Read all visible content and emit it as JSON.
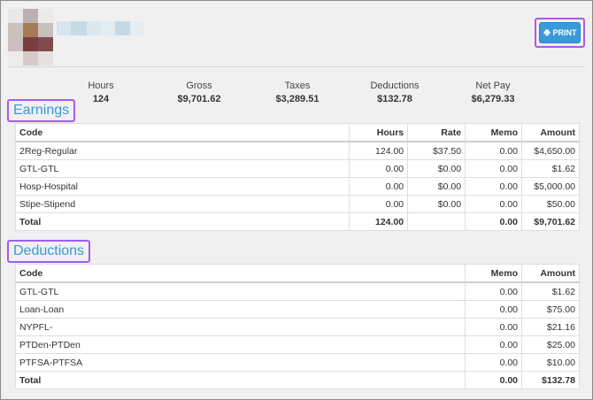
{
  "header": {
    "print_label": "PRINT"
  },
  "summary": {
    "items": [
      {
        "label": "Hours",
        "value": "124"
      },
      {
        "label": "Gross",
        "value": "$9,701.62"
      },
      {
        "label": "Taxes",
        "value": "$3,289.51"
      },
      {
        "label": "Deductions",
        "value": "$132.78"
      },
      {
        "label": "Net Pay",
        "value": "$6,279.33"
      }
    ]
  },
  "earnings": {
    "title": "Earnings",
    "columns": [
      "Code",
      "Hours",
      "Rate",
      "Memo",
      "Amount"
    ],
    "rows": [
      {
        "code": "2Reg-Regular",
        "hours": "124.00",
        "rate": "$37.50",
        "memo": "0.00",
        "amount": "$4,650.00"
      },
      {
        "code": "GTL-GTL",
        "hours": "0.00",
        "rate": "$0.00",
        "memo": "0.00",
        "amount": "$1.62"
      },
      {
        "code": "Hosp-Hospital",
        "hours": "0.00",
        "rate": "$0.00",
        "memo": "0.00",
        "amount": "$5,000.00"
      },
      {
        "code": "Stipe-Stipend",
        "hours": "0.00",
        "rate": "$0.00",
        "memo": "0.00",
        "amount": "$50.00"
      }
    ],
    "total": {
      "code": "Total",
      "hours": "124.00",
      "rate": "",
      "memo": "0.00",
      "amount": "$9,701.62"
    }
  },
  "deductions": {
    "title": "Deductions",
    "columns": [
      "Code",
      "Memo",
      "Amount"
    ],
    "rows": [
      {
        "code": "GTL-GTL",
        "memo": "0.00",
        "amount": "$1.62"
      },
      {
        "code": "Loan-Loan",
        "memo": "0.00",
        "amount": "$75.00"
      },
      {
        "code": "NYPFL-",
        "memo": "0.00",
        "amount": "$21.16"
      },
      {
        "code": "PTDen-PTDen",
        "memo": "0.00",
        "amount": "$25.00"
      },
      {
        "code": "PTFSA-PTFSA",
        "memo": "0.00",
        "amount": "$10.00"
      }
    ],
    "total": {
      "code": "Total",
      "memo": "0.00",
      "amount": "$132.78"
    }
  },
  "colors": {
    "accent": "#3a9ad9",
    "highlight": "#a45cf2"
  },
  "icons": {
    "print": "printer-icon"
  }
}
